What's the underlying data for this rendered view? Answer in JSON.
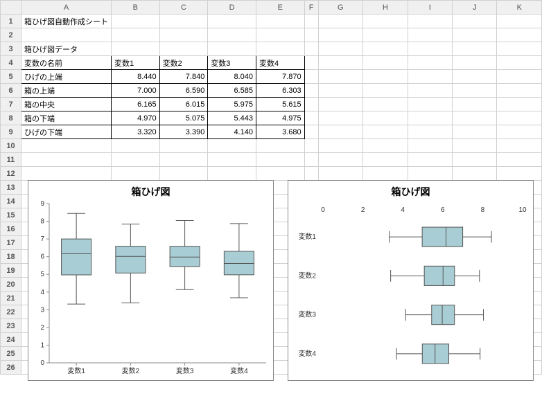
{
  "columns": [
    "A",
    "B",
    "C",
    "D",
    "E",
    "F",
    "G",
    "H",
    "I",
    "J",
    "K"
  ],
  "rows": [
    "1",
    "2",
    "3",
    "4",
    "5",
    "6",
    "7",
    "8",
    "9",
    "10",
    "11",
    "12",
    "13",
    "14",
    "15",
    "16",
    "17",
    "18",
    "19",
    "20",
    "21",
    "22",
    "23",
    "24",
    "25",
    "26"
  ],
  "cells": {
    "A1": "箱ひげ図自動作成シート",
    "A3": "箱ひげ図データ",
    "A4": "変数の名前",
    "B4": "変数1",
    "C4": "変数2",
    "D4": "変数3",
    "E4": "変数4",
    "A5": "ひげの上端",
    "B5": "8.440",
    "C5": "7.840",
    "D5": "8.040",
    "E5": "7.870",
    "A6": "箱の上端",
    "B6": "7.000",
    "C6": "6.590",
    "D6": "6.585",
    "E6": "6.303",
    "A7": "箱の中央",
    "B7": "6.165",
    "C7": "6.015",
    "D7": "5.975",
    "E7": "5.615",
    "A8": "箱の下端",
    "B8": "4.970",
    "C8": "5.075",
    "D8": "5.443",
    "E8": "4.975",
    "A9": "ひげの下端",
    "B9": "3.320",
    "C9": "3.390",
    "D9": "4.140",
    "E9": "3.680"
  },
  "chart1": {
    "title": "箱ひげ図",
    "y_ticks": [
      0,
      1,
      2,
      3,
      4,
      5,
      6,
      7,
      8,
      9
    ],
    "cats": [
      "変数1",
      "変数2",
      "変数3",
      "変数4"
    ]
  },
  "chart2": {
    "title": "箱ひげ図",
    "x_ticks": [
      0,
      2,
      4,
      6,
      8,
      10
    ],
    "cats": [
      "変数1",
      "変数2",
      "変数3",
      "変数4"
    ]
  },
  "chart_data": {
    "type": "boxplot",
    "title": "箱ひげ図",
    "orientation_charts": [
      "vertical",
      "horizontal"
    ],
    "categories": [
      "変数1",
      "変数2",
      "変数3",
      "変数4"
    ],
    "series": [
      {
        "name": "変数1",
        "whisker_high": 8.44,
        "q3": 7.0,
        "median": 6.165,
        "q1": 4.97,
        "whisker_low": 3.32
      },
      {
        "name": "変数2",
        "whisker_high": 7.84,
        "q3": 6.59,
        "median": 6.015,
        "q1": 5.075,
        "whisker_low": 3.39
      },
      {
        "name": "変数3",
        "whisker_high": 8.04,
        "q3": 6.585,
        "median": 5.975,
        "q1": 5.443,
        "whisker_low": 4.14
      },
      {
        "name": "変数4",
        "whisker_high": 7.87,
        "q3": 6.303,
        "median": 5.615,
        "q1": 4.975,
        "whisker_low": 3.68
      }
    ],
    "ylim": [
      0,
      9
    ],
    "xlim_horizontal": [
      0,
      10
    ]
  }
}
